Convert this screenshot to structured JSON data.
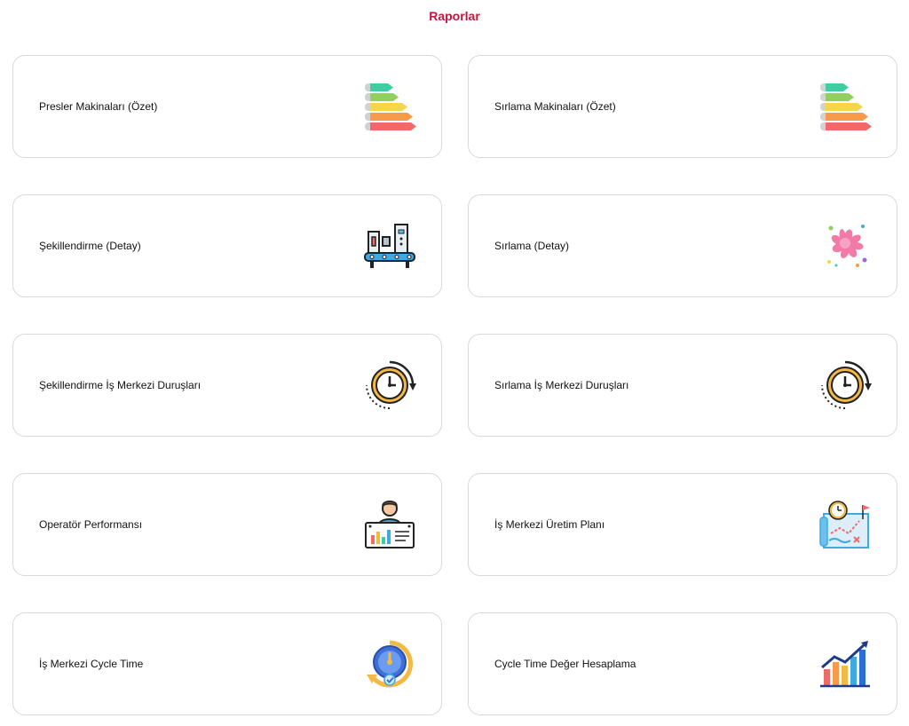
{
  "page": {
    "title": "Raporlar"
  },
  "cards": [
    {
      "label": "Presler Makinaları (Özet)",
      "icon": "energy-rating-icon"
    },
    {
      "label": "Sırlama Makinaları (Özet)",
      "icon": "energy-rating-icon"
    },
    {
      "label": "Şekillendirme (Detay)",
      "icon": "machine-conveyor-icon"
    },
    {
      "label": "Sırlama (Detay)",
      "icon": "paint-splash-icon"
    },
    {
      "label": "Şekillendirme İş Merkezi Duruşları",
      "icon": "clock-cycle-icon"
    },
    {
      "label": "Sırlama İş Merkezi Duruşları",
      "icon": "clock-cycle-icon"
    },
    {
      "label": "Operatör Performansı",
      "icon": "operator-chart-icon"
    },
    {
      "label": "İş Merkezi Üretim Planı",
      "icon": "production-plan-icon"
    },
    {
      "label": "İş Merkezi Cycle Time",
      "icon": "gauge-icon"
    },
    {
      "label": "Cycle Time Değer Hesaplama",
      "icon": "growth-chart-icon"
    }
  ]
}
